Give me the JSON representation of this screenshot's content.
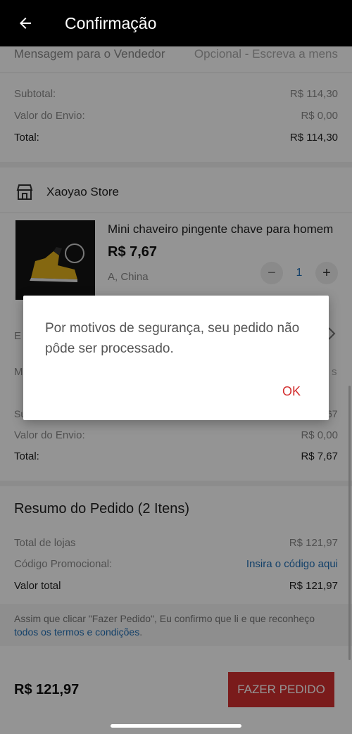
{
  "header": {
    "title": "Confirmação"
  },
  "section1": {
    "message_label": "Mensagem para o Vendedor",
    "message_placeholder": "Opcional - Escreva a mens",
    "subtotal_label": "Subtotal:",
    "subtotal_value": "R$ 114,30",
    "shipping_label": "Valor do Envio:",
    "shipping_value": "R$ 0,00",
    "total_label": "Total:",
    "total_value": "R$ 114,30"
  },
  "store": {
    "name": "Xaoyao Store",
    "product": {
      "title": "Mini chaveiro pingente chave para homem",
      "price": "R$ 7,67",
      "variant": "A, China",
      "quantity": "1"
    },
    "partial_left_1": "E",
    "partial_left_2": "M",
    "partial_right_2": "s",
    "partial_left_3": "Su",
    "partial_right_3": "67",
    "shipping_label": "Valor do Envio:",
    "shipping_value": "R$ 0,00",
    "total_label": "Total:",
    "total_value": "R$ 7,67"
  },
  "summary": {
    "title": "Resumo do Pedido (2 Itens)",
    "stores_label": "Total de lojas",
    "stores_value": "R$ 121,97",
    "promo_label": "Código Promocional:",
    "promo_link": "Insira o código aqui",
    "grand_label": "Valor total",
    "grand_value": "R$ 121,97"
  },
  "terms": {
    "text": "Assim que clicar \"Fazer Pedido\", Eu confirmo que li e que reconheço ",
    "link": "todos os termos e condições",
    "end": "."
  },
  "footer": {
    "total": "R$ 121,97",
    "button": "FAZER PEDIDO"
  },
  "dialog": {
    "message": "Por motivos de segurança, seu pedido não pôde ser processado.",
    "ok": "OK"
  },
  "colors": {
    "accent": "#d32f2f",
    "link": "#1f6fb6",
    "topbar": "#000000"
  }
}
